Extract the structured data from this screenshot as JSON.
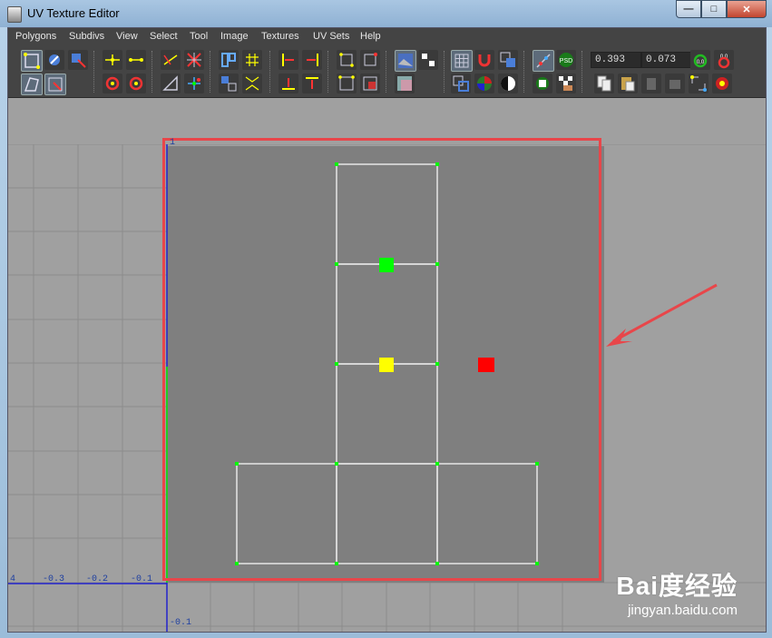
{
  "window": {
    "title": "UV Texture Editor"
  },
  "menu": [
    "Polygons",
    "Subdivs",
    "View",
    "Select",
    "Tool",
    "Image",
    "Textures",
    "UV Sets",
    "Help"
  ],
  "toolbar": {
    "u_value": "0.393",
    "v_value": "0.073",
    "zero_label_1": "0,0",
    "zero_label_2": "0,0",
    "psd_label": "PSD"
  },
  "axis_labels": {
    "x_neg_4": "4",
    "x_neg_3": "-0.3",
    "x_neg_2": "-0.2",
    "x_neg_1": "-0.1",
    "y_top": "1",
    "y_neg_1": "-0.1"
  },
  "watermark": {
    "main": "Bai度经验",
    "sub": "jingyan.baidu.com"
  },
  "colors": {
    "highlight": "#e8464a",
    "face_green": "#00ff00",
    "face_yellow": "#ffff00",
    "face_red": "#ff0000",
    "uv_edge": "#ffffff",
    "uv_vertex": "#00ff00"
  }
}
